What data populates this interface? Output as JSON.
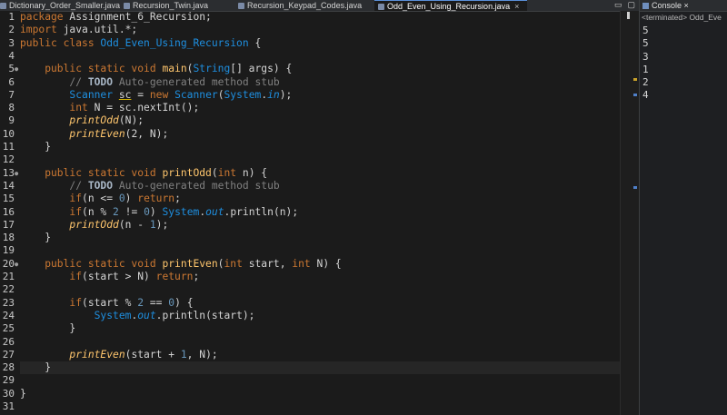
{
  "tabs": [
    {
      "label": "Dictionary_Order_Smaller.java",
      "active": false
    },
    {
      "label": "Recursion_Twin.java",
      "active": false
    },
    {
      "label": "Recursion_Keypad_Codes.java",
      "active": false
    },
    {
      "label": "Odd_Even_Using_Recursion.java",
      "active": true,
      "close": "×"
    }
  ],
  "window_controls": {
    "minimize": "▭",
    "maximize": "▢"
  },
  "console": {
    "tab_label": "Console",
    "tab_close": "×",
    "status": "<terminated> Odd_Eve",
    "output": [
      "5",
      "5",
      "3",
      "1",
      "2",
      "4"
    ]
  },
  "editor": {
    "current_line": 28,
    "lines": [
      {
        "n": "1",
        "tokens": [
          {
            "t": "package ",
            "c": "kw"
          },
          {
            "t": "Assignment_6_Recursion;",
            "c": ""
          }
        ]
      },
      {
        "n": "2",
        "tokens": [
          {
            "t": "import ",
            "c": "kw"
          },
          {
            "t": "java.util.*;",
            "c": ""
          }
        ]
      },
      {
        "n": "3",
        "tokens": [
          {
            "t": "public class ",
            "c": "kw"
          },
          {
            "t": "Odd_Even_Using_Recursion",
            "c": "ty"
          },
          {
            "t": " {",
            "c": ""
          }
        ]
      },
      {
        "n": "4",
        "tokens": []
      },
      {
        "n": "5",
        "fold": true,
        "tokens": [
          {
            "t": "    public static void ",
            "c": "kw"
          },
          {
            "t": "main",
            "c": "fn"
          },
          {
            "t": "(",
            "c": ""
          },
          {
            "t": "String",
            "c": "ty"
          },
          {
            "t": "[] args) {",
            "c": ""
          }
        ]
      },
      {
        "n": "6",
        "tokens": [
          {
            "t": "        // ",
            "c": "cm"
          },
          {
            "t": "TODO",
            "c": "td"
          },
          {
            "t": " Auto-generated method stub",
            "c": "cm"
          }
        ]
      },
      {
        "n": "7",
        "tokens": [
          {
            "t": "        ",
            "c": ""
          },
          {
            "t": "Scanner ",
            "c": "ty"
          },
          {
            "t": "sc",
            "c": "wv"
          },
          {
            "t": " = ",
            "c": ""
          },
          {
            "t": "new ",
            "c": "kw"
          },
          {
            "t": "Scanner",
            "c": "ty"
          },
          {
            "t": "(",
            "c": ""
          },
          {
            "t": "System",
            "c": "ty"
          },
          {
            "t": ".",
            "c": ""
          },
          {
            "t": "in",
            "c": "st"
          },
          {
            "t": ");",
            "c": ""
          }
        ]
      },
      {
        "n": "8",
        "tokens": [
          {
            "t": "        ",
            "c": ""
          },
          {
            "t": "int ",
            "c": "kw"
          },
          {
            "t": "N = sc.nextInt();",
            "c": ""
          }
        ]
      },
      {
        "n": "9",
        "tokens": [
          {
            "t": "        ",
            "c": ""
          },
          {
            "t": "printOdd",
            "c": "it"
          },
          {
            "t": "(N);",
            "c": ""
          }
        ]
      },
      {
        "n": "10",
        "tokens": [
          {
            "t": "        ",
            "c": ""
          },
          {
            "t": "printEven",
            "c": "it"
          },
          {
            "t": "(2, N);",
            "c": ""
          }
        ]
      },
      {
        "n": "11",
        "tokens": [
          {
            "t": "    }",
            "c": ""
          }
        ]
      },
      {
        "n": "12",
        "tokens": []
      },
      {
        "n": "13",
        "fold": true,
        "tokens": [
          {
            "t": "    public static void ",
            "c": "kw"
          },
          {
            "t": "printOdd",
            "c": "fn"
          },
          {
            "t": "(",
            "c": ""
          },
          {
            "t": "int ",
            "c": "kw"
          },
          {
            "t": "n) {",
            "c": ""
          }
        ]
      },
      {
        "n": "14",
        "tokens": [
          {
            "t": "        // ",
            "c": "cm"
          },
          {
            "t": "TODO",
            "c": "td"
          },
          {
            "t": " Auto-generated method stub",
            "c": "cm"
          }
        ]
      },
      {
        "n": "15",
        "tokens": [
          {
            "t": "        ",
            "c": ""
          },
          {
            "t": "if",
            "c": "kw"
          },
          {
            "t": "(n <= ",
            "c": ""
          },
          {
            "t": "0",
            "c": "nm"
          },
          {
            "t": ") ",
            "c": ""
          },
          {
            "t": "return",
            "c": "kw"
          },
          {
            "t": ";",
            "c": ""
          }
        ]
      },
      {
        "n": "16",
        "tokens": [
          {
            "t": "        ",
            "c": ""
          },
          {
            "t": "if",
            "c": "kw"
          },
          {
            "t": "(n % ",
            "c": ""
          },
          {
            "t": "2",
            "c": "nm"
          },
          {
            "t": " != ",
            "c": ""
          },
          {
            "t": "0",
            "c": "nm"
          },
          {
            "t": ") ",
            "c": ""
          },
          {
            "t": "System",
            "c": "ty"
          },
          {
            "t": ".",
            "c": ""
          },
          {
            "t": "out",
            "c": "st"
          },
          {
            "t": ".println(n);",
            "c": ""
          }
        ]
      },
      {
        "n": "17",
        "tokens": [
          {
            "t": "        ",
            "c": ""
          },
          {
            "t": "printOdd",
            "c": "it"
          },
          {
            "t": "(n - ",
            "c": ""
          },
          {
            "t": "1",
            "c": "nm"
          },
          {
            "t": ");",
            "c": ""
          }
        ]
      },
      {
        "n": "18",
        "tokens": [
          {
            "t": "    }",
            "c": ""
          }
        ]
      },
      {
        "n": "19",
        "tokens": []
      },
      {
        "n": "20",
        "fold": true,
        "tokens": [
          {
            "t": "    public static void ",
            "c": "kw"
          },
          {
            "t": "printEven",
            "c": "fn"
          },
          {
            "t": "(",
            "c": ""
          },
          {
            "t": "int ",
            "c": "kw"
          },
          {
            "t": "start, ",
            "c": ""
          },
          {
            "t": "int ",
            "c": "kw"
          },
          {
            "t": "N) {",
            "c": ""
          }
        ]
      },
      {
        "n": "21",
        "tokens": [
          {
            "t": "        ",
            "c": ""
          },
          {
            "t": "if",
            "c": "kw"
          },
          {
            "t": "(start > N) ",
            "c": ""
          },
          {
            "t": "return",
            "c": "kw"
          },
          {
            "t": ";",
            "c": ""
          }
        ]
      },
      {
        "n": "22",
        "tokens": []
      },
      {
        "n": "23",
        "tokens": [
          {
            "t": "        ",
            "c": ""
          },
          {
            "t": "if",
            "c": "kw"
          },
          {
            "t": "(start % ",
            "c": ""
          },
          {
            "t": "2",
            "c": "nm"
          },
          {
            "t": " == ",
            "c": ""
          },
          {
            "t": "0",
            "c": "nm"
          },
          {
            "t": ") {",
            "c": ""
          }
        ]
      },
      {
        "n": "24",
        "tokens": [
          {
            "t": "            ",
            "c": ""
          },
          {
            "t": "System",
            "c": "ty"
          },
          {
            "t": ".",
            "c": ""
          },
          {
            "t": "out",
            "c": "st"
          },
          {
            "t": ".println(start);",
            "c": ""
          }
        ]
      },
      {
        "n": "25",
        "tokens": [
          {
            "t": "        }",
            "c": ""
          }
        ]
      },
      {
        "n": "26",
        "tokens": []
      },
      {
        "n": "27",
        "tokens": [
          {
            "t": "        ",
            "c": ""
          },
          {
            "t": "printEven",
            "c": "it"
          },
          {
            "t": "(start + ",
            "c": ""
          },
          {
            "t": "1",
            "c": "nm"
          },
          {
            "t": ", N);",
            "c": ""
          }
        ]
      },
      {
        "n": "28",
        "tokens": [
          {
            "t": "    }",
            "c": ""
          }
        ]
      },
      {
        "n": "29",
        "tokens": []
      },
      {
        "n": "30",
        "tokens": [
          {
            "t": "}",
            "c": ""
          }
        ]
      },
      {
        "n": "31",
        "tokens": []
      }
    ]
  }
}
